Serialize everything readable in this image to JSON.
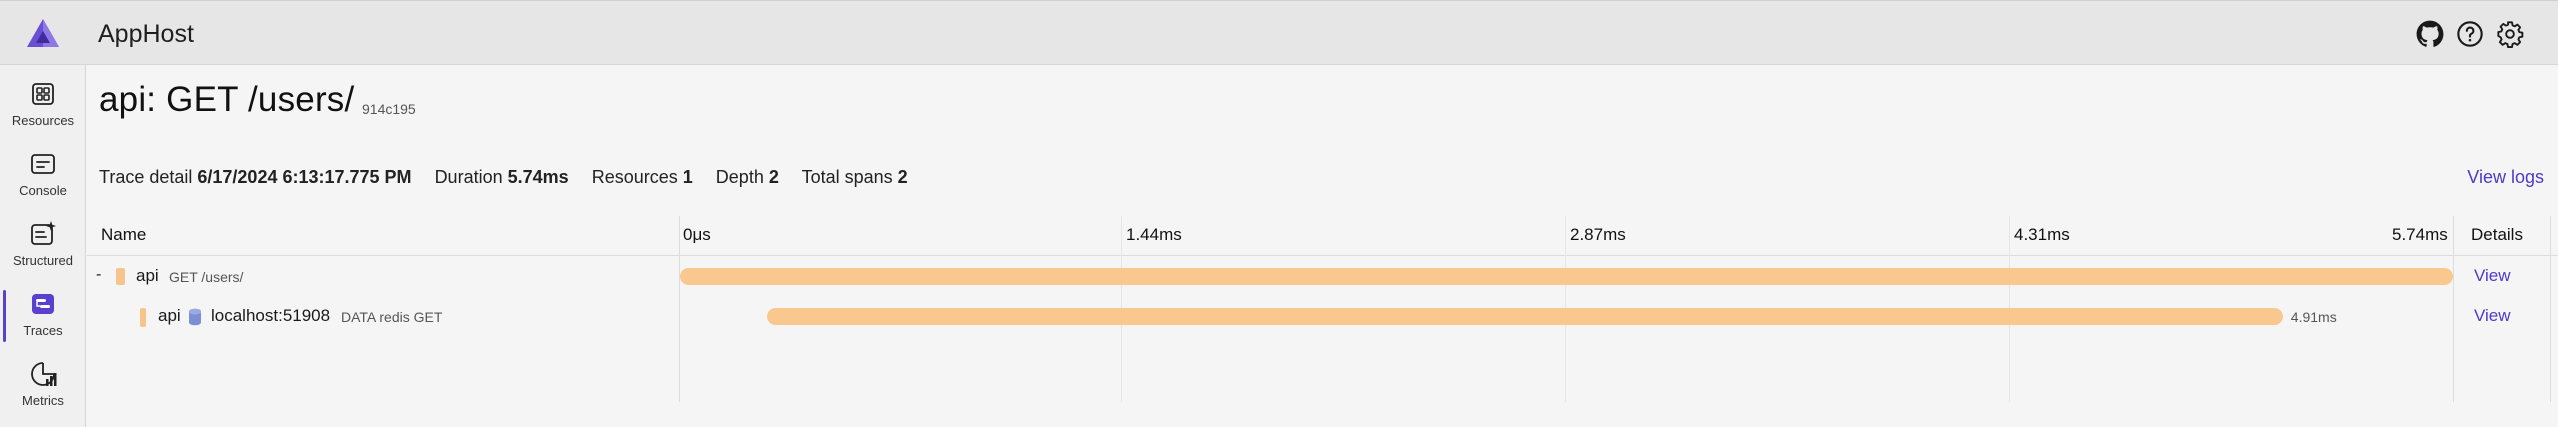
{
  "app": {
    "title": "AppHost"
  },
  "header_icons": [
    "github-icon",
    "help-icon",
    "settings-icon"
  ],
  "sidebar": {
    "items": [
      {
        "label": "Resources",
        "icon": "resources-icon",
        "active": false
      },
      {
        "label": "Console",
        "icon": "console-icon",
        "active": false
      },
      {
        "label": "Structured",
        "icon": "structured-icon",
        "active": false
      },
      {
        "label": "Traces",
        "icon": "traces-icon",
        "active": true
      },
      {
        "label": "Metrics",
        "icon": "metrics-icon",
        "active": false
      }
    ]
  },
  "page": {
    "title": "api: GET /users/",
    "trace_id": "914c195"
  },
  "summary": {
    "trace_detail_label": "Trace detail",
    "trace_detail_value": "6/17/2024 6:13:17.775 PM",
    "duration_label": "Duration",
    "duration_value": "5.74ms",
    "resources_label": "Resources",
    "resources_value": "1",
    "depth_label": "Depth",
    "depth_value": "2",
    "total_spans_label": "Total spans",
    "total_spans_value": "2",
    "view_logs": "View logs"
  },
  "grid": {
    "name_header": "Name",
    "details_header": "Details",
    "ticks": [
      "0μs",
      "1.44ms",
      "2.87ms",
      "4.31ms",
      "5.74ms"
    ]
  },
  "spans": [
    {
      "toggle": "-",
      "resource": "api",
      "name": "GET /users/",
      "start_fraction": 0.0,
      "end_fraction": 1.0,
      "duration_label": "",
      "details": "View"
    },
    {
      "toggle": "",
      "resource": "api",
      "target": "localhost:51908",
      "name": "DATA redis GET",
      "start_fraction": 0.049,
      "end_fraction": 0.904,
      "duration_label": "4.91ms",
      "details": "View"
    }
  ],
  "colors": {
    "accent": "#5b3fcf",
    "link": "#4b3cc9",
    "span_bar": "#f9c88f",
    "db_icon": "#7b8fd6"
  }
}
